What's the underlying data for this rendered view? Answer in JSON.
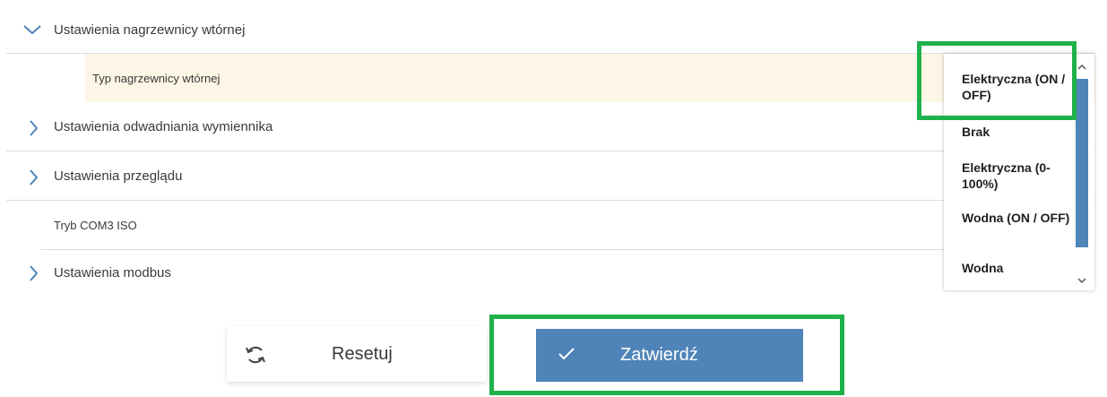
{
  "settings_list": {
    "rows": [
      {
        "label": "Ustawienia nagrzewnicy wtórnej",
        "expanded": true
      },
      {
        "label": "Ustawienia odwadniania wymiennika",
        "expanded": false
      },
      {
        "label": "Ustawienia przeglądu",
        "expanded": false
      },
      {
        "label": "Tryb COM3 ISO"
      },
      {
        "label": "Ustawienia modbus",
        "expanded": false
      }
    ],
    "sub_row": {
      "label": "Typ nagrzewnicy wtórnej"
    }
  },
  "dropdown": {
    "selected": "Elektryczna (ON / OFF)",
    "options": [
      "Elektryczna (ON / OFF)",
      "Brak",
      "Elektryczna (0-100%)",
      "Wodna (ON / OFF)",
      "Wodna"
    ]
  },
  "footer": {
    "reset_label": "Resetuj",
    "confirm_label": "Zatwierdź"
  },
  "colors": {
    "accent": "#4f84b8",
    "highlight": "#1fb14b",
    "sub_row_bg": "#fdf6e6"
  },
  "icons": [
    "chevron-down-icon",
    "chevron-right-icon",
    "refresh-icon",
    "check-icon",
    "scroll-up-icon",
    "scroll-down-icon"
  ]
}
